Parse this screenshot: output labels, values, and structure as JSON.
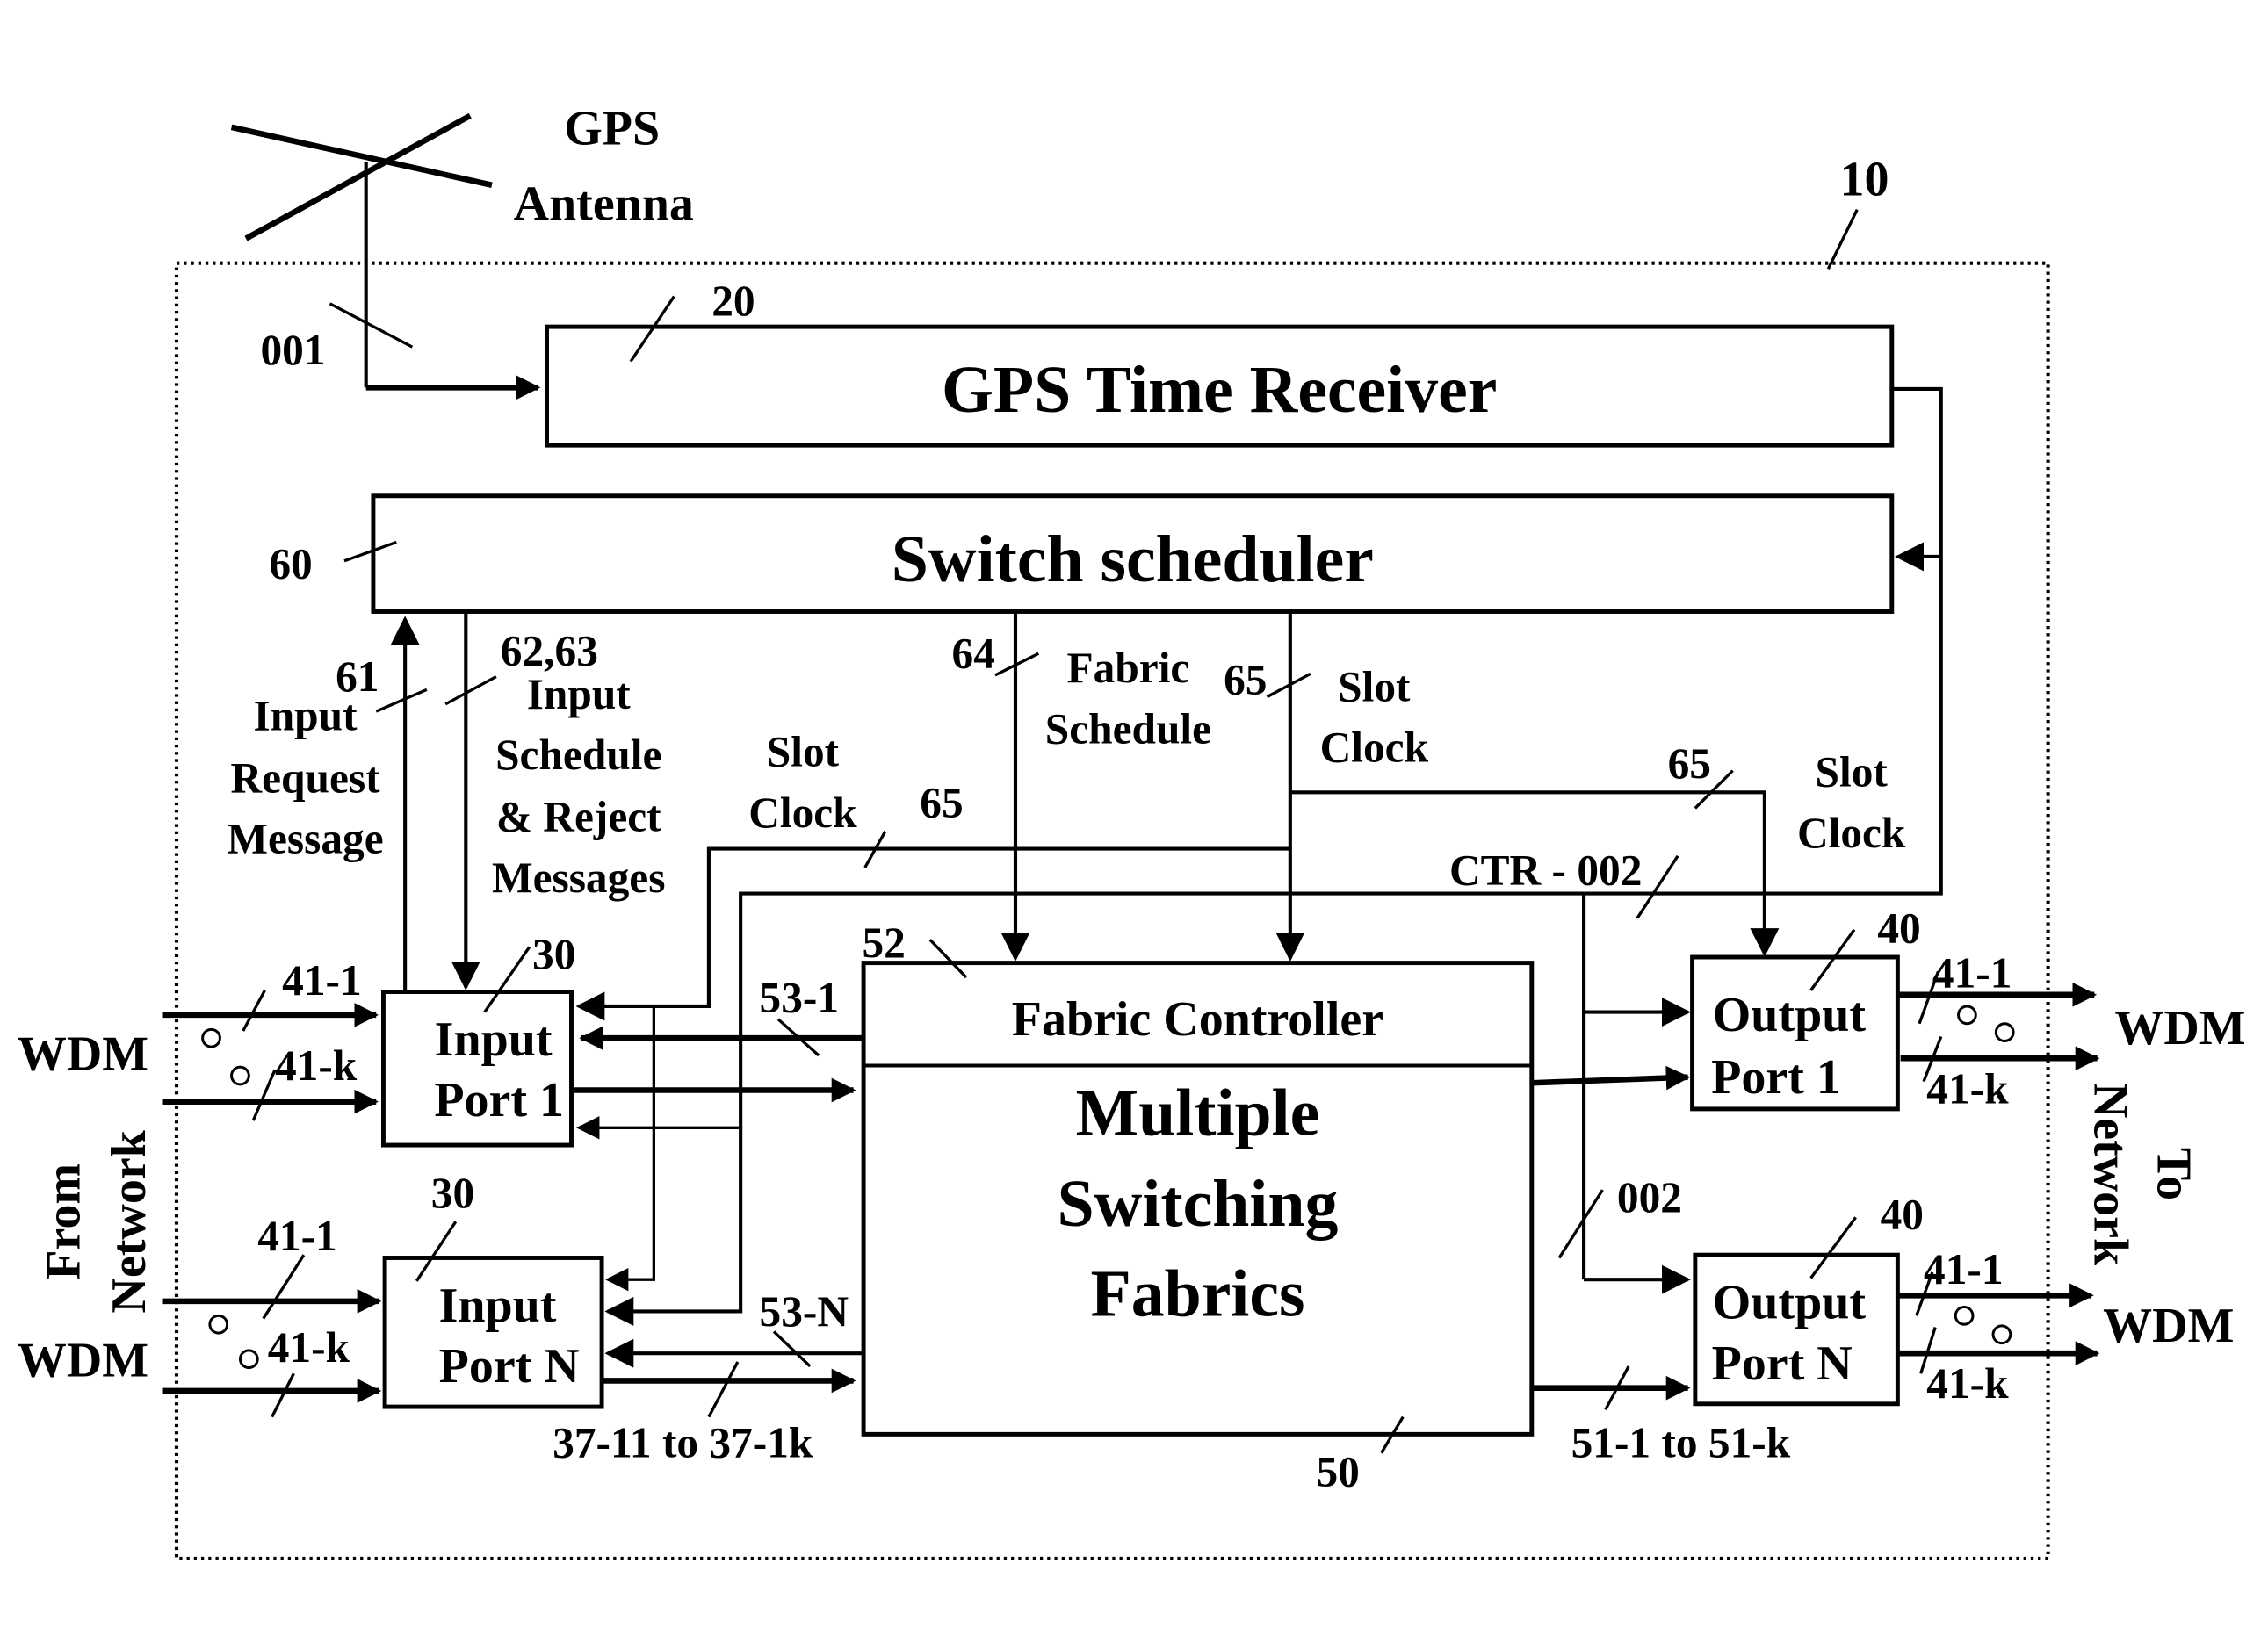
{
  "diagram": {
    "system_ref": "10",
    "antenna": {
      "label_line1": "GPS",
      "label_line2": "Antenna",
      "link_ref": "001"
    },
    "gps_receiver": {
      "ref": "20",
      "label": "GPS Time Receiver"
    },
    "switch_scheduler": {
      "ref": "60",
      "label": "Switch scheduler"
    },
    "signals": {
      "input_request": {
        "ref": "61",
        "lines": [
          "Input",
          "Request",
          "Message"
        ]
      },
      "input_schedule": {
        "ref": "62,63",
        "lines": [
          "Input",
          "Schedule",
          "& Reject",
          "Messages"
        ]
      },
      "fabric_schedule": {
        "ref": "64",
        "lines": [
          "Fabric",
          "Schedule"
        ]
      },
      "slot_clock_center": {
        "ref": "65",
        "lines": [
          "Slot",
          "Clock"
        ]
      },
      "slot_clock_left": {
        "ref": "65",
        "lines": [
          "Slot",
          "Clock"
        ]
      },
      "slot_clock_right": {
        "ref": "65",
        "lines": [
          "Slot",
          "Clock"
        ]
      },
      "ctr": {
        "label": "CTR - 002"
      },
      "ctr_branch": {
        "label": "002"
      }
    },
    "fabric": {
      "ref": "50",
      "controller_ref": "52",
      "controller_label": "Fabric Controller",
      "lines": [
        "Multiple",
        "Switching",
        "Fabrics"
      ],
      "in_link_1": "53-1",
      "in_link_n": "53-N",
      "in_bus": "37-11 to 37-1k",
      "out_bus": "51-1 to 51-k"
    },
    "input_ports": [
      {
        "ref": "30",
        "line1": "Input",
        "line2": "Port 1",
        "ch_first": "41-1",
        "ch_last": "41-k"
      },
      {
        "ref": "30",
        "line1": "Input",
        "line2": "Port N",
        "ch_first": "41-1",
        "ch_last": "41-k"
      }
    ],
    "output_ports": [
      {
        "ref": "40",
        "line1": "Output",
        "line2": "Port 1",
        "ch_first": "41-1",
        "ch_last": "41-k"
      },
      {
        "ref": "40",
        "line1": "Output",
        "line2": "Port N",
        "ch_first": "41-1",
        "ch_last": "41-k"
      }
    ],
    "left_side": {
      "wdm_top": "WDM",
      "wdm_bottom": "WDM",
      "from_line1": "From",
      "from_line2": "Network"
    },
    "right_side": {
      "wdm_top": "WDM",
      "wdm_bottom": "WDM",
      "to_line1": "To",
      "to_line2": "Network"
    }
  }
}
